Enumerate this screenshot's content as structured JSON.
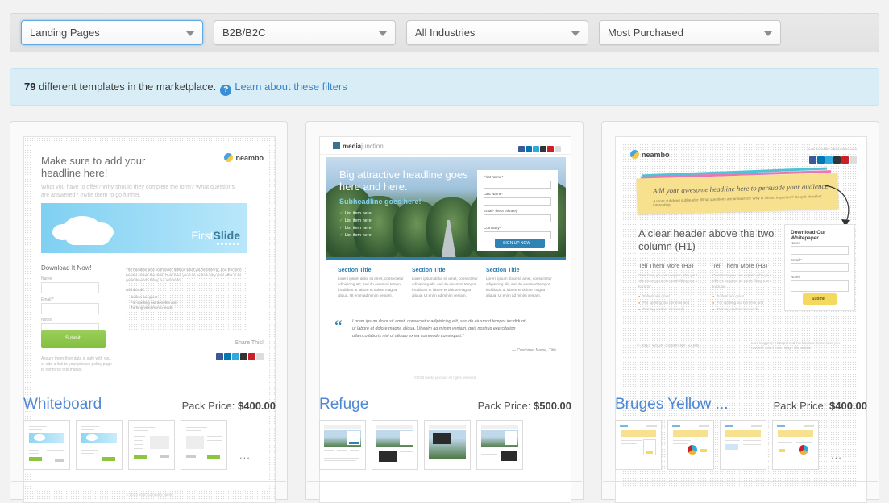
{
  "filters": [
    {
      "name": "type-filter",
      "value": "Landing Pages",
      "focused": true
    },
    {
      "name": "audience-filter",
      "value": "B2B/B2C",
      "focused": false
    },
    {
      "name": "industry-filter",
      "value": "All Industries",
      "focused": false
    },
    {
      "name": "sort-filter",
      "value": "Most Purchased",
      "focused": false
    }
  ],
  "info": {
    "count": "79",
    "text": " different templates in the marketplace.",
    "help_icon": "question-mark-icon",
    "link": "Learn about these filters"
  },
  "colors": {
    "accent_link": "#4e87d3",
    "info_bg": "#d9edf7",
    "page_bg": "#f2f2f2",
    "card_bg": "#fafafa"
  },
  "cards": [
    {
      "title": "Whiteboard",
      "price_label": "Pack Price: ",
      "price": "$400.00",
      "more": "...",
      "preview": {
        "headline": "Make sure to add your headline here!",
        "subheadline": "What you have to offer? Why should they complete the form? What questions are answered? Invite them to go further.",
        "logo": "neambo",
        "hero_caption_light": "First",
        "hero_caption_bold": "Slide",
        "form_title": "Download It Now!",
        "fields": [
          "Name",
          "Email *",
          "Notes"
        ],
        "submit": "Submit",
        "panel_p1": "The headline and subheader tells us what you're offering, and the form header closes the deal. Over here you can explain why your offer is so great its worth filling out a form for.",
        "panel_p2": "Remember:",
        "panel_bullets": [
          "Bullets are great",
          "For spelling out benefits and",
          "Turning visitors into leads."
        ],
        "privacy_note": "Assure them their data is safe with you, or add a link to your privacy policy page to reinforce this matter.",
        "share_label": "Share This!",
        "footer": "© 2013 Your Company Name"
      }
    },
    {
      "title": "Refuge",
      "price_label": "Pack Price: ",
      "price": "$500.00",
      "more": "",
      "preview": {
        "logo_bold": "media",
        "logo_light": "junction",
        "headline": "Big attractive headline goes here and here.",
        "subheadline": "Subheadline goes here!",
        "list_items": [
          "List item here",
          "List item here",
          "List item here",
          "List item here"
        ],
        "fields": [
          "First Name*",
          "Last Name*",
          "Email* (kept private)",
          "Company*"
        ],
        "submit": "SIGN UP NOW",
        "sections": [
          {
            "title": "Section Title",
            "body": "Lorem ipsum dolor sit amet, consectetur adipisicing elit, sed do eiusmod tempor incididunt ut labore et dolore magna aliqua. Ut enim ad minim veniam."
          },
          {
            "title": "Section Title",
            "body": "Lorem ipsum dolor sit amet, consectetur adipisicing elit, sed do eiusmod tempor incididunt ut labore et dolore magna aliqua. Ut enim ad minim veniam."
          },
          {
            "title": "Section Title",
            "body": "Lorem ipsum dolor sit amet, consectetur adipisicing elit, sed do eiusmod tempor incididunt ut labore et dolore magna aliqua. Ut enim ad minim veniam."
          }
        ],
        "quote": "Lorem ipsum dolor sit amet, consectetur adipisicing elit, sed do eiusmod tempor incididunt ut labore et dolore magna aliqua. Ut enim ad minim veniam, quis nostrud exercitation ullamco laboris nisi ut aliquip ex ea commodo consequat.\"",
        "quote_author": "— Customer Name, Title",
        "footer": "©2013 media junction. All rights reserved."
      }
    },
    {
      "title": "Bruges Yellow ...",
      "price_label": "Pack Price: ",
      "price": "$400.00",
      "more": "...",
      "preview": {
        "logo": "neambo",
        "phone": "Call us Today: (800) 555-1234",
        "script_headline": "Add your awesome headline here to persuade your audience",
        "subheadline": "A more subdued subheader. What questions are answered? Why is this so important? Keep it short but interesting.",
        "h1": "A clear header above the two column (H1)",
        "columns": [
          {
            "title": "Tell Them More (H3)",
            "body": "Over here you can explain why your offer is so great its worth filling out a form for.",
            "bullets": [
              "Bullets are great",
              "For spelling out benefits and",
              "Turning visitors into leads."
            ]
          },
          {
            "title": "Tell Them More (H3)",
            "body": "Over here you can explain why your offer is so great its worth filling out a form for.",
            "bullets": [
              "Bullets are great",
              "For spelling out benefits and",
              "Turning visitors into leads."
            ]
          }
        ],
        "form_title": "Download Our Whitepaper",
        "fields": [
          "Name",
          "Email *",
          "Notes"
        ],
        "submit": "Submit",
        "footer": "© 2013 YOUR COMPANY NAME",
        "credit": "Love blogging? HubSpot and this fabulous theme have you covered. Learn more: blog - this website"
      }
    }
  ]
}
